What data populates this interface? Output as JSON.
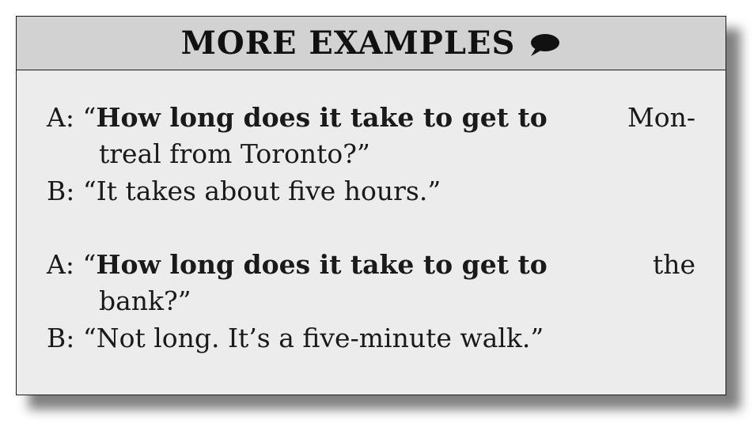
{
  "header": {
    "title": "MORE EXAMPLES"
  },
  "examples": [
    {
      "a_speaker": "A:",
      "a_open_quote": "“",
      "a_bold": "How long does it take to get to",
      "a_rest_line1": "Mon-",
      "a_line2": "treal from Toronto?”",
      "b_speaker": "B:",
      "b_text": "“It takes about five hours.”"
    },
    {
      "a_speaker": "A:",
      "a_open_quote": "“",
      "a_bold": "How long does it take to get to",
      "a_rest_line1": "the",
      "a_line2": "bank?”",
      "b_speaker": "B:",
      "b_text": "“Not long. It’s a five-minute walk.”"
    }
  ]
}
